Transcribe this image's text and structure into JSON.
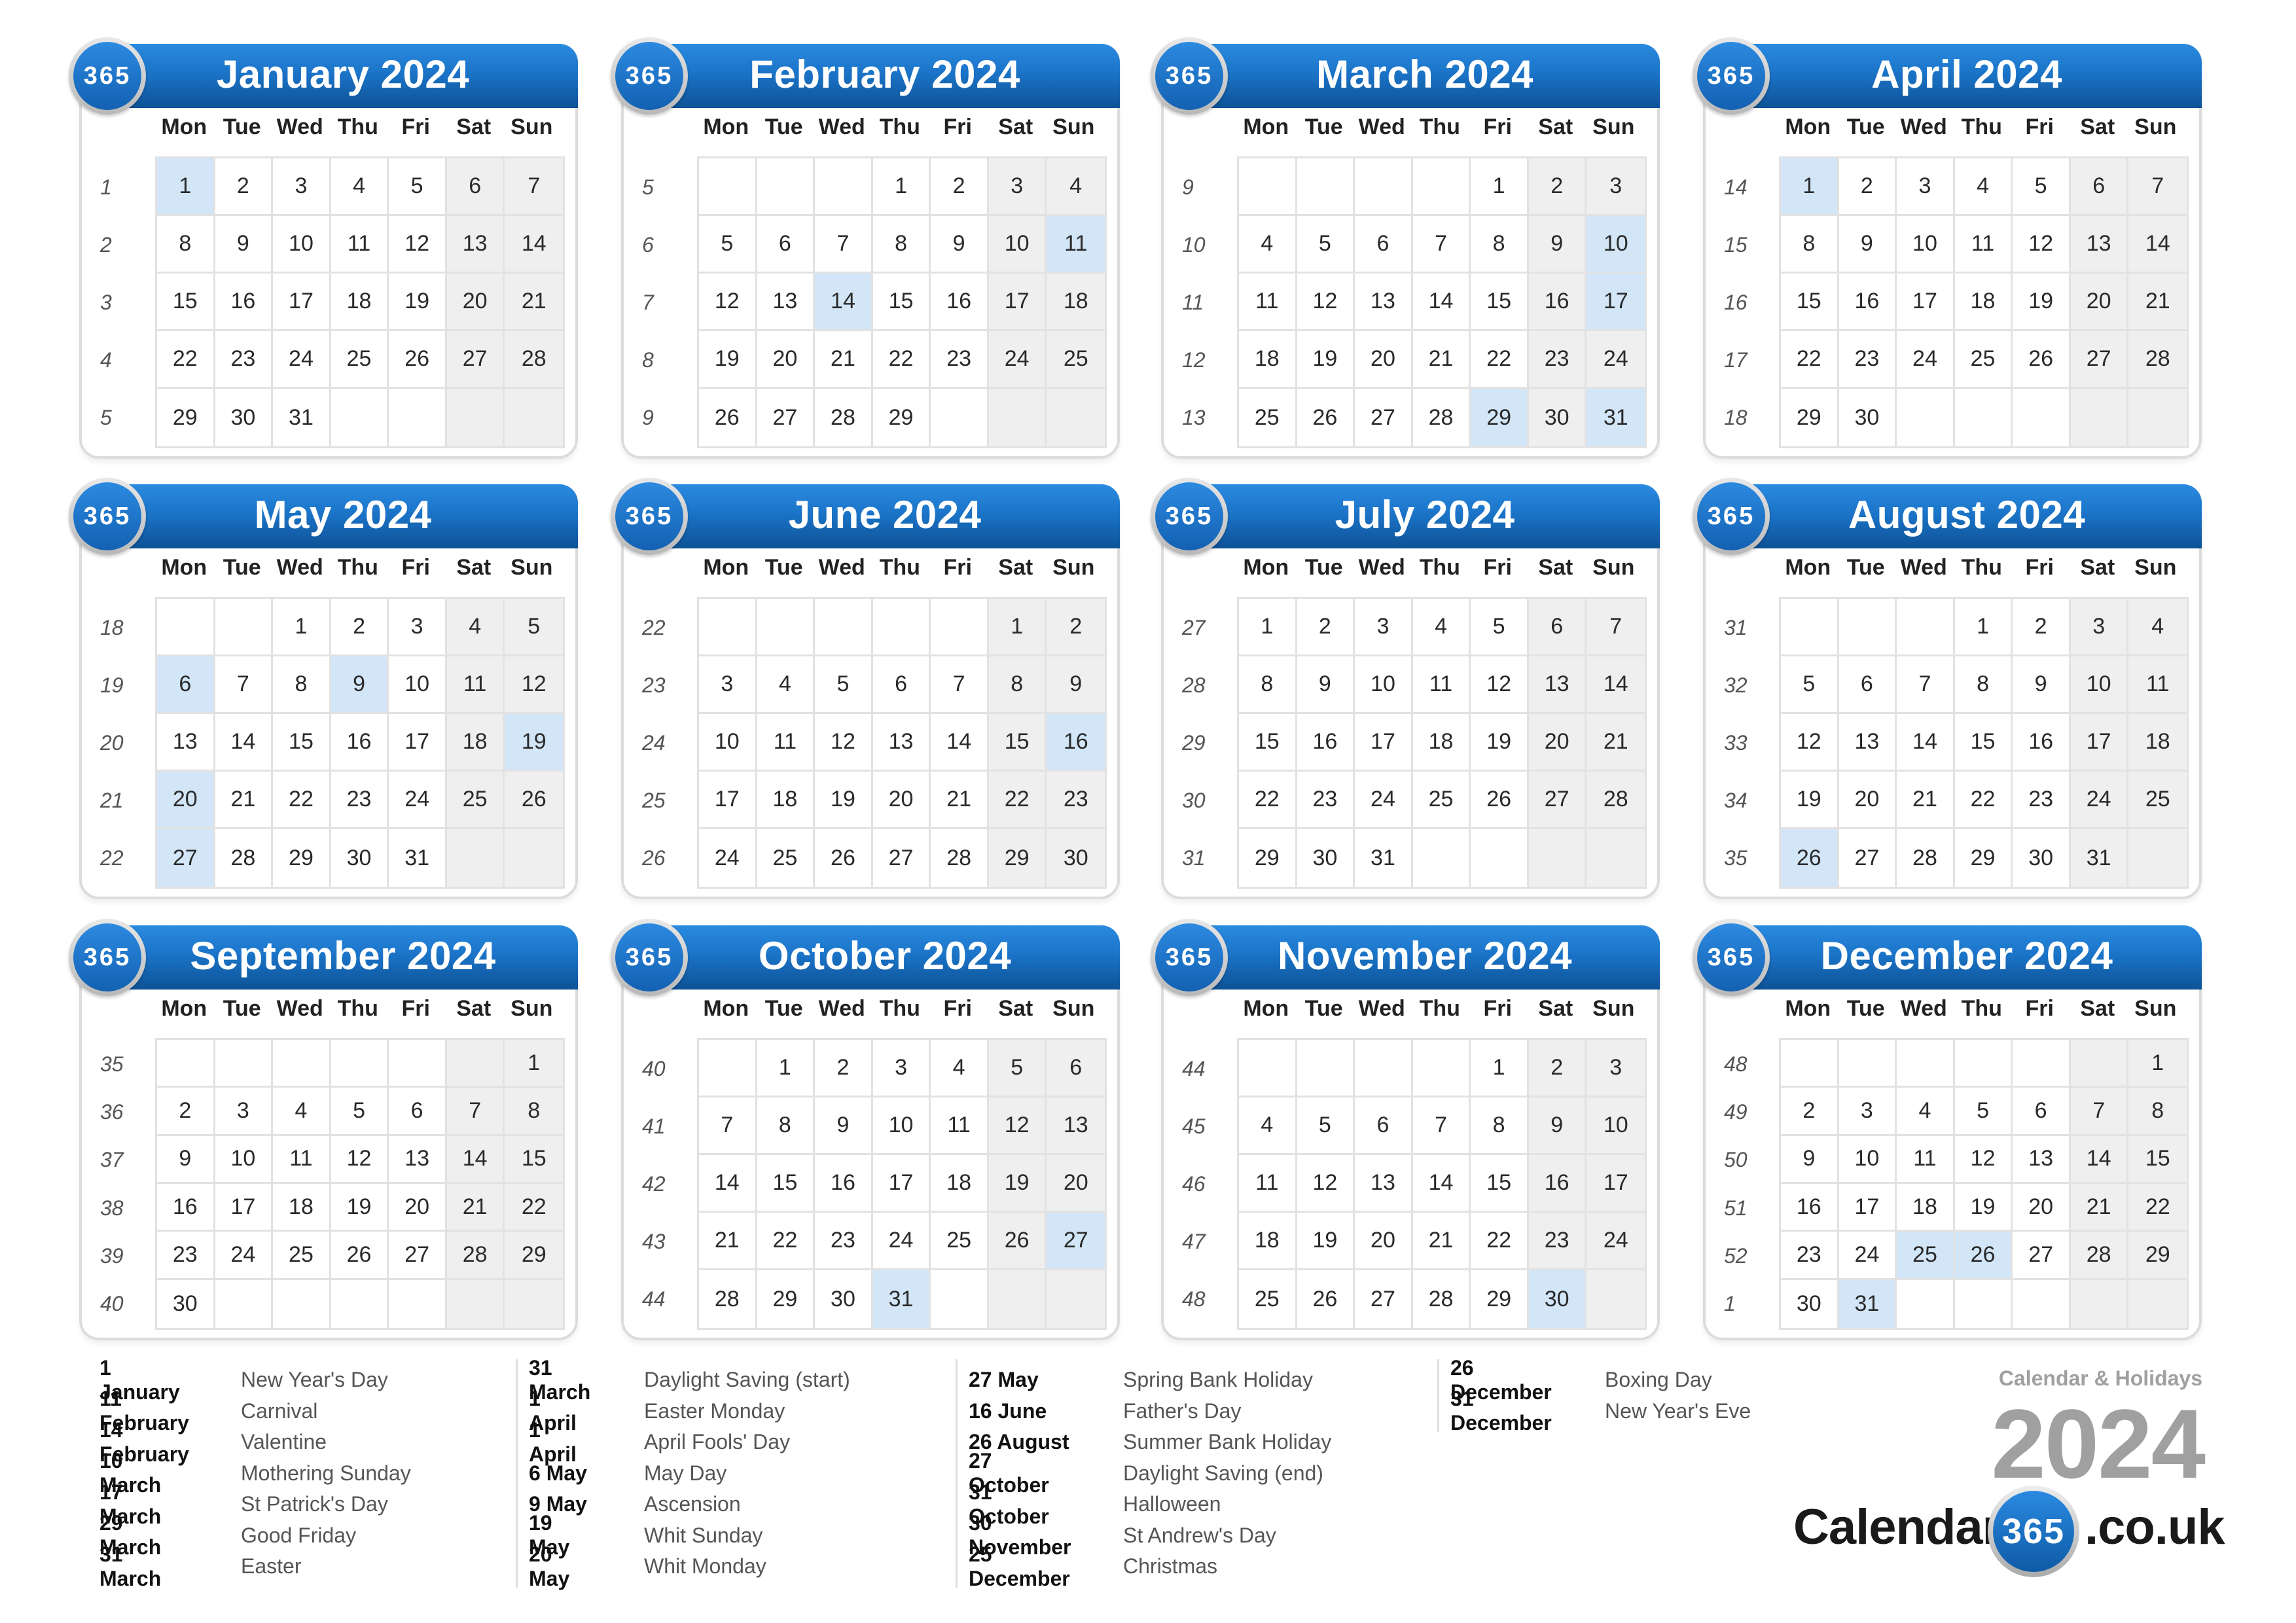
{
  "badge_text": "365",
  "weekday_headers": [
    "Mon",
    "Tue",
    "Wed",
    "Thu",
    "Fri",
    "Sat",
    "Sun"
  ],
  "colors": {
    "header_blue": "#1b74c8",
    "holiday_highlight": "#d2e6f8",
    "weekend_shade": "#efefef",
    "brand_grey": "#a0a0a0"
  },
  "months": [
    {
      "title": "January 2024",
      "weeks": [
        {
          "wk": "1",
          "days": [
            "1",
            "2",
            "3",
            "4",
            "5",
            "6",
            "7"
          ]
        },
        {
          "wk": "2",
          "days": [
            "8",
            "9",
            "10",
            "11",
            "12",
            "13",
            "14"
          ]
        },
        {
          "wk": "3",
          "days": [
            "15",
            "16",
            "17",
            "18",
            "19",
            "20",
            "21"
          ]
        },
        {
          "wk": "4",
          "days": [
            "22",
            "23",
            "24",
            "25",
            "26",
            "27",
            "28"
          ]
        },
        {
          "wk": "5",
          "days": [
            "29",
            "30",
            "31",
            "",
            "",
            "",
            ""
          ]
        }
      ],
      "holidays": [
        "1"
      ]
    },
    {
      "title": "February 2024",
      "weeks": [
        {
          "wk": "5",
          "days": [
            "",
            "",
            "",
            "1",
            "2",
            "3",
            "4"
          ]
        },
        {
          "wk": "6",
          "days": [
            "5",
            "6",
            "7",
            "8",
            "9",
            "10",
            "11"
          ]
        },
        {
          "wk": "7",
          "days": [
            "12",
            "13",
            "14",
            "15",
            "16",
            "17",
            "18"
          ]
        },
        {
          "wk": "8",
          "days": [
            "19",
            "20",
            "21",
            "22",
            "23",
            "24",
            "25"
          ]
        },
        {
          "wk": "9",
          "days": [
            "26",
            "27",
            "28",
            "29",
            "",
            "",
            ""
          ]
        }
      ],
      "holidays": [
        "11",
        "14"
      ]
    },
    {
      "title": "March 2024",
      "weeks": [
        {
          "wk": "9",
          "days": [
            "",
            "",
            "",
            "",
            "1",
            "2",
            "3"
          ]
        },
        {
          "wk": "10",
          "days": [
            "4",
            "5",
            "6",
            "7",
            "8",
            "9",
            "10"
          ]
        },
        {
          "wk": "11",
          "days": [
            "11",
            "12",
            "13",
            "14",
            "15",
            "16",
            "17"
          ]
        },
        {
          "wk": "12",
          "days": [
            "18",
            "19",
            "20",
            "21",
            "22",
            "23",
            "24"
          ]
        },
        {
          "wk": "13",
          "days": [
            "25",
            "26",
            "27",
            "28",
            "29",
            "30",
            "31"
          ]
        }
      ],
      "holidays": [
        "10",
        "17",
        "29",
        "31"
      ]
    },
    {
      "title": "April 2024",
      "weeks": [
        {
          "wk": "14",
          "days": [
            "1",
            "2",
            "3",
            "4",
            "5",
            "6",
            "7"
          ]
        },
        {
          "wk": "15",
          "days": [
            "8",
            "9",
            "10",
            "11",
            "12",
            "13",
            "14"
          ]
        },
        {
          "wk": "16",
          "days": [
            "15",
            "16",
            "17",
            "18",
            "19",
            "20",
            "21"
          ]
        },
        {
          "wk": "17",
          "days": [
            "22",
            "23",
            "24",
            "25",
            "26",
            "27",
            "28"
          ]
        },
        {
          "wk": "18",
          "days": [
            "29",
            "30",
            "",
            "",
            "",
            "",
            ""
          ]
        }
      ],
      "holidays": [
        "1"
      ]
    },
    {
      "title": "May 2024",
      "weeks": [
        {
          "wk": "18",
          "days": [
            "",
            "",
            "1",
            "2",
            "3",
            "4",
            "5"
          ]
        },
        {
          "wk": "19",
          "days": [
            "6",
            "7",
            "8",
            "9",
            "10",
            "11",
            "12"
          ]
        },
        {
          "wk": "20",
          "days": [
            "13",
            "14",
            "15",
            "16",
            "17",
            "18",
            "19"
          ]
        },
        {
          "wk": "21",
          "days": [
            "20",
            "21",
            "22",
            "23",
            "24",
            "25",
            "26"
          ]
        },
        {
          "wk": "22",
          "days": [
            "27",
            "28",
            "29",
            "30",
            "31",
            "",
            ""
          ]
        }
      ],
      "holidays": [
        "6",
        "9",
        "19",
        "20",
        "27"
      ]
    },
    {
      "title": "June 2024",
      "weeks": [
        {
          "wk": "22",
          "days": [
            "",
            "",
            "",
            "",
            "",
            "1",
            "2"
          ]
        },
        {
          "wk": "23",
          "days": [
            "3",
            "4",
            "5",
            "6",
            "7",
            "8",
            "9"
          ]
        },
        {
          "wk": "24",
          "days": [
            "10",
            "11",
            "12",
            "13",
            "14",
            "15",
            "16"
          ]
        },
        {
          "wk": "25",
          "days": [
            "17",
            "18",
            "19",
            "20",
            "21",
            "22",
            "23"
          ]
        },
        {
          "wk": "26",
          "days": [
            "24",
            "25",
            "26",
            "27",
            "28",
            "29",
            "30"
          ]
        }
      ],
      "holidays": [
        "16"
      ]
    },
    {
      "title": "July 2024",
      "weeks": [
        {
          "wk": "27",
          "days": [
            "1",
            "2",
            "3",
            "4",
            "5",
            "6",
            "7"
          ]
        },
        {
          "wk": "28",
          "days": [
            "8",
            "9",
            "10",
            "11",
            "12",
            "13",
            "14"
          ]
        },
        {
          "wk": "29",
          "days": [
            "15",
            "16",
            "17",
            "18",
            "19",
            "20",
            "21"
          ]
        },
        {
          "wk": "30",
          "days": [
            "22",
            "23",
            "24",
            "25",
            "26",
            "27",
            "28"
          ]
        },
        {
          "wk": "31",
          "days": [
            "29",
            "30",
            "31",
            "",
            "",
            "",
            ""
          ]
        }
      ],
      "holidays": []
    },
    {
      "title": "August 2024",
      "weeks": [
        {
          "wk": "31",
          "days": [
            "",
            "",
            "",
            "1",
            "2",
            "3",
            "4"
          ]
        },
        {
          "wk": "32",
          "days": [
            "5",
            "6",
            "7",
            "8",
            "9",
            "10",
            "11"
          ]
        },
        {
          "wk": "33",
          "days": [
            "12",
            "13",
            "14",
            "15",
            "16",
            "17",
            "18"
          ]
        },
        {
          "wk": "34",
          "days": [
            "19",
            "20",
            "21",
            "22",
            "23",
            "24",
            "25"
          ]
        },
        {
          "wk": "35",
          "days": [
            "26",
            "27",
            "28",
            "29",
            "30",
            "31",
            ""
          ]
        }
      ],
      "holidays": [
        "26"
      ]
    },
    {
      "title": "September 2024",
      "weeks": [
        {
          "wk": "35",
          "days": [
            "",
            "",
            "",
            "",
            "",
            "",
            "1"
          ]
        },
        {
          "wk": "36",
          "days": [
            "2",
            "3",
            "4",
            "5",
            "6",
            "7",
            "8"
          ]
        },
        {
          "wk": "37",
          "days": [
            "9",
            "10",
            "11",
            "12",
            "13",
            "14",
            "15"
          ]
        },
        {
          "wk": "38",
          "days": [
            "16",
            "17",
            "18",
            "19",
            "20",
            "21",
            "22"
          ]
        },
        {
          "wk": "39",
          "days": [
            "23",
            "24",
            "25",
            "26",
            "27",
            "28",
            "29"
          ]
        },
        {
          "wk": "40",
          "days": [
            "30",
            "",
            "",
            "",
            "",
            "",
            ""
          ]
        }
      ],
      "holidays": []
    },
    {
      "title": "October 2024",
      "weeks": [
        {
          "wk": "40",
          "days": [
            "",
            "1",
            "2",
            "3",
            "4",
            "5",
            "6"
          ]
        },
        {
          "wk": "41",
          "days": [
            "7",
            "8",
            "9",
            "10",
            "11",
            "12",
            "13"
          ]
        },
        {
          "wk": "42",
          "days": [
            "14",
            "15",
            "16",
            "17",
            "18",
            "19",
            "20"
          ]
        },
        {
          "wk": "43",
          "days": [
            "21",
            "22",
            "23",
            "24",
            "25",
            "26",
            "27"
          ]
        },
        {
          "wk": "44",
          "days": [
            "28",
            "29",
            "30",
            "31",
            "",
            "",
            ""
          ]
        }
      ],
      "holidays": [
        "27",
        "31"
      ]
    },
    {
      "title": "November 2024",
      "weeks": [
        {
          "wk": "44",
          "days": [
            "",
            "",
            "",
            "",
            "1",
            "2",
            "3"
          ]
        },
        {
          "wk": "45",
          "days": [
            "4",
            "5",
            "6",
            "7",
            "8",
            "9",
            "10"
          ]
        },
        {
          "wk": "46",
          "days": [
            "11",
            "12",
            "13",
            "14",
            "15",
            "16",
            "17"
          ]
        },
        {
          "wk": "47",
          "days": [
            "18",
            "19",
            "20",
            "21",
            "22",
            "23",
            "24"
          ]
        },
        {
          "wk": "48",
          "days": [
            "25",
            "26",
            "27",
            "28",
            "29",
            "30",
            ""
          ]
        }
      ],
      "holidays": [
        "30"
      ]
    },
    {
      "title": "December 2024",
      "weeks": [
        {
          "wk": "48",
          "days": [
            "",
            "",
            "",
            "",
            "",
            "",
            "1"
          ]
        },
        {
          "wk": "49",
          "days": [
            "2",
            "3",
            "4",
            "5",
            "6",
            "7",
            "8"
          ]
        },
        {
          "wk": "50",
          "days": [
            "9",
            "10",
            "11",
            "12",
            "13",
            "14",
            "15"
          ]
        },
        {
          "wk": "51",
          "days": [
            "16",
            "17",
            "18",
            "19",
            "20",
            "21",
            "22"
          ]
        },
        {
          "wk": "52",
          "days": [
            "23",
            "24",
            "25",
            "26",
            "27",
            "28",
            "29"
          ]
        },
        {
          "wk": "1",
          "days": [
            "30",
            "31",
            "",
            "",
            "",
            "",
            ""
          ]
        }
      ],
      "holidays": [
        "25",
        "26",
        "31"
      ]
    }
  ],
  "holiday_columns": [
    [
      {
        "date": "1 January",
        "name": "New Year's Day"
      },
      {
        "date": "11 February",
        "name": "Carnival"
      },
      {
        "date": "14 February",
        "name": "Valentine"
      },
      {
        "date": "10 March",
        "name": "Mothering Sunday"
      },
      {
        "date": "17 March",
        "name": "St Patrick's Day"
      },
      {
        "date": "29 March",
        "name": "Good Friday"
      },
      {
        "date": "31 March",
        "name": "Easter"
      }
    ],
    [
      {
        "date": "31 March",
        "name": "Daylight Saving (start)"
      },
      {
        "date": "1 April",
        "name": "Easter Monday"
      },
      {
        "date": "1 April",
        "name": "April Fools' Day"
      },
      {
        "date": "6 May",
        "name": "May Day"
      },
      {
        "date": "9 May",
        "name": "Ascension"
      },
      {
        "date": "19 May",
        "name": "Whit Sunday"
      },
      {
        "date": "20 May",
        "name": "Whit Monday"
      }
    ],
    [
      {
        "date": "27 May",
        "name": "Spring Bank Holiday"
      },
      {
        "date": "16 June",
        "name": "Father's Day"
      },
      {
        "date": "26 August",
        "name": "Summer Bank Holiday"
      },
      {
        "date": "27 October",
        "name": "Daylight Saving (end)"
      },
      {
        "date": "31 October",
        "name": "Halloween"
      },
      {
        "date": "30 November",
        "name": "St Andrew's Day"
      },
      {
        "date": "25 December",
        "name": "Christmas"
      }
    ],
    [
      {
        "date": "26 December",
        "name": "Boxing Day"
      },
      {
        "date": "31 December",
        "name": "New Year's Eve"
      }
    ]
  ],
  "branding": {
    "subtitle": "Calendar & Holidays",
    "year": "2024",
    "logo_left": "Calendar-",
    "logo_circle": "365",
    "logo_right": ".co.uk"
  }
}
